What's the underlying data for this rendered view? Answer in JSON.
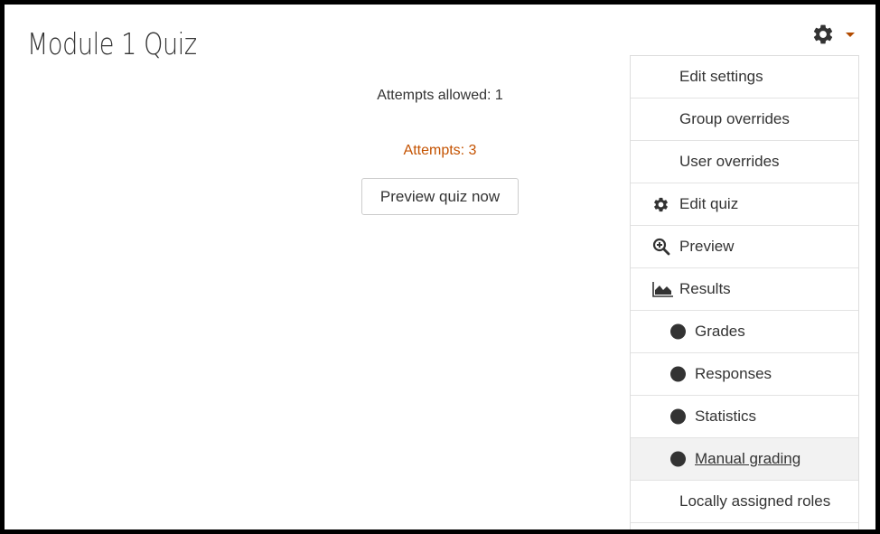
{
  "page": {
    "title": "Module 1 Quiz"
  },
  "quiz_info": {
    "attempts_allowed": "Attempts allowed: 1",
    "attempts": "Attempts: 3",
    "preview_button": "Preview quiz now"
  },
  "settings_menu": {
    "toggle_icon": "gear-icon",
    "items": [
      {
        "label": "Edit settings",
        "icon": ""
      },
      {
        "label": "Group overrides",
        "icon": ""
      },
      {
        "label": "User overrides",
        "icon": ""
      },
      {
        "label": "Edit quiz",
        "icon": "gear-icon"
      },
      {
        "label": "Preview",
        "icon": "magnify-plus-icon"
      },
      {
        "label": "Results",
        "icon": "area-chart-icon"
      },
      {
        "label": "Grades",
        "icon": "bullet-icon"
      },
      {
        "label": "Responses",
        "icon": "bullet-icon"
      },
      {
        "label": "Statistics",
        "icon": "bullet-icon"
      },
      {
        "label": "Manual grading",
        "icon": "bullet-icon",
        "active": true
      },
      {
        "label": "Locally assigned roles",
        "icon": ""
      }
    ]
  },
  "colors": {
    "accent": "#c45200",
    "text": "#333333",
    "active_bg": "#f2f2f2"
  }
}
